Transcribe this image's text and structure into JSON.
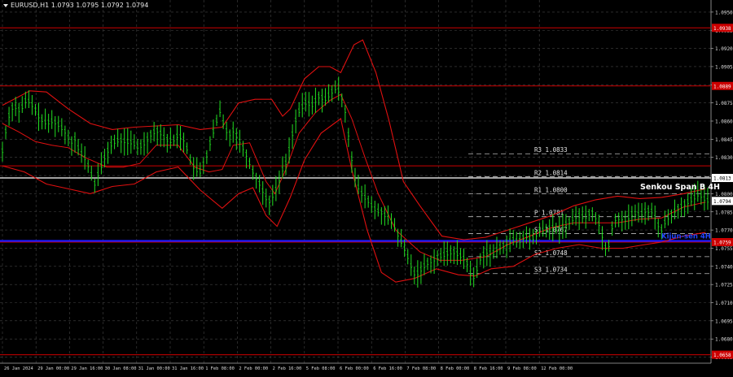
{
  "header": {
    "title": "EURUSD,H1  1.0793 1.0795 1.0792 1.0794"
  },
  "chart_data": {
    "type": "line",
    "title": "EURUSD,H1",
    "y_ticks": [
      "1.0950",
      "1.0935",
      "1.0920",
      "1.0905",
      "1.0890",
      "1.0875",
      "1.0860",
      "1.0845",
      "1.0830",
      "1.0815",
      "1.0800",
      "1.0785",
      "1.0770",
      "1.0755",
      "1.0740",
      "1.0725",
      "1.0710",
      "1.0695",
      "1.0680",
      "1.0665"
    ],
    "x_ticks": [
      "26 Jan 2024",
      "29 Jan 00:00",
      "29 Jan 16:00",
      "30 Jan 08:00",
      "31 Jan 00:00",
      "31 Jan 16:00",
      "1 Feb 08:00",
      "2 Feb 00:00",
      "2 Feb 16:00",
      "5 Feb 08:00",
      "6 Feb 00:00",
      "6 Feb 16:00",
      "7 Feb 08:00",
      "8 Feb 00:00",
      "8 Feb 16:00",
      "9 Feb 08:00",
      "12 Feb 00:00"
    ],
    "ylim": [
      1.066,
      1.096
    ],
    "price_labels": [
      {
        "text": "1.0938",
        "value": 1.0937,
        "color": "#cc0000"
      },
      {
        "text": "1.0889",
        "value": 1.0889,
        "color": "#cc0000"
      },
      {
        "text": "1.0813",
        "value": 1.0813,
        "color": "#ffffff"
      },
      {
        "text": "1.0794",
        "value": 1.0794,
        "color": "#ffffff"
      },
      {
        "text": "1.0759",
        "value": 1.076,
        "color": "#cc0000"
      },
      {
        "text": "1.0658",
        "value": 1.0667,
        "color": "#cc0000"
      }
    ],
    "pivots": [
      {
        "label": "R3 1.0833",
        "value": 1.0833
      },
      {
        "label": "R2 1.0814",
        "value": 1.0814
      },
      {
        "label": "R1 1.0800",
        "value": 1.08
      },
      {
        "label": "P 1.0781",
        "value": 1.0781
      },
      {
        "label": "S1 1.0767",
        "value": 1.0767
      },
      {
        "label": "S2 1.0748",
        "value": 1.0748
      },
      {
        "label": "S3 1.0734",
        "value": 1.0734
      }
    ],
    "levels": [
      {
        "value": 1.0937,
        "color": "#cc0000"
      },
      {
        "value": 1.0889,
        "color": "#cc0000"
      },
      {
        "value": 1.0823,
        "color": "#cc0000"
      },
      {
        "value": 1.076,
        "color": "#cc0000"
      },
      {
        "value": 1.0667,
        "color": "#cc0000"
      }
    ],
    "senkou_label": "Senkou Span B 4H",
    "senkou_value": 1.0813,
    "kijun_label": "Kijun-sen 4H",
    "kijun_value": 1.0761,
    "bollinger_mid": [
      [
        0,
        1.0858
      ],
      [
        15,
        1.0851
      ],
      [
        30,
        1.0843
      ],
      [
        45,
        1.084
      ],
      [
        60,
        1.0838
      ],
      [
        75,
        1.083
      ],
      [
        95,
        1.0822
      ],
      [
        110,
        1.0822
      ],
      [
        125,
        1.0825
      ],
      [
        140,
        1.084
      ],
      [
        150,
        1.084
      ],
      [
        160,
        1.084
      ],
      [
        175,
        1.0822
      ],
      [
        188,
        1.0818
      ],
      [
        200,
        1.082
      ],
      [
        210,
        1.084
      ],
      [
        225,
        1.0842
      ],
      [
        240,
        1.081
      ],
      [
        248,
        1.08
      ],
      [
        258,
        1.082
      ],
      [
        270,
        1.085
      ],
      [
        285,
        1.0867
      ],
      [
        298,
        1.0877
      ],
      [
        308,
        1.0882
      ],
      [
        318,
        1.0862
      ],
      [
        330,
        1.083
      ],
      [
        342,
        1.08
      ],
      [
        358,
        1.077
      ],
      [
        380,
        1.0752
      ],
      [
        398,
        1.0745
      ],
      [
        418,
        1.0745
      ],
      [
        440,
        1.0748
      ],
      [
        460,
        1.0758
      ],
      [
        480,
        1.0765
      ],
      [
        500,
        1.0772
      ],
      [
        520,
        1.0776
      ],
      [
        540,
        1.0776
      ],
      [
        560,
        1.0776
      ],
      [
        580,
        1.0779
      ],
      [
        600,
        1.078
      ],
      [
        620,
        1.0789
      ],
      [
        640,
        1.0793
      ]
    ],
    "bollinger_upper": [
      [
        0,
        1.0873
      ],
      [
        25,
        1.0885
      ],
      [
        40,
        1.0884
      ],
      [
        60,
        1.087
      ],
      [
        80,
        1.0858
      ],
      [
        100,
        1.0853
      ],
      [
        120,
        1.0855
      ],
      [
        140,
        1.0856
      ],
      [
        160,
        1.0857
      ],
      [
        180,
        1.0853
      ],
      [
        200,
        1.0855
      ],
      [
        215,
        1.0875
      ],
      [
        230,
        1.0878
      ],
      [
        245,
        1.0878
      ],
      [
        255,
        1.0864
      ],
      [
        262,
        1.087
      ],
      [
        275,
        1.0895
      ],
      [
        288,
        1.0905
      ],
      [
        298,
        1.0905
      ],
      [
        308,
        1.09
      ],
      [
        320,
        1.0923
      ],
      [
        328,
        1.0927
      ],
      [
        340,
        1.09
      ],
      [
        352,
        1.086
      ],
      [
        365,
        1.081
      ],
      [
        380,
        1.079
      ],
      [
        400,
        1.0765
      ],
      [
        420,
        1.0762
      ],
      [
        440,
        1.0764
      ],
      [
        460,
        1.077
      ],
      [
        480,
        1.0776
      ],
      [
        500,
        1.0782
      ],
      [
        520,
        1.079
      ],
      [
        540,
        1.0795
      ],
      [
        560,
        1.0798
      ],
      [
        580,
        1.0796
      ],
      [
        600,
        1.0797
      ],
      [
        620,
        1.08
      ],
      [
        640,
        1.0804
      ]
    ],
    "bollinger_lower": [
      [
        0,
        1.0823
      ],
      [
        20,
        1.0818
      ],
      [
        40,
        1.0808
      ],
      [
        60,
        1.0804
      ],
      [
        80,
        1.08
      ],
      [
        100,
        1.0806
      ],
      [
        120,
        1.0808
      ],
      [
        140,
        1.0818
      ],
      [
        160,
        1.0822
      ],
      [
        180,
        1.0803
      ],
      [
        200,
        1.0788
      ],
      [
        215,
        1.08
      ],
      [
        228,
        1.0805
      ],
      [
        240,
        1.0782
      ],
      [
        250,
        1.0773
      ],
      [
        262,
        1.0797
      ],
      [
        275,
        1.0828
      ],
      [
        290,
        1.085
      ],
      [
        308,
        1.0862
      ],
      [
        318,
        1.082
      ],
      [
        332,
        1.077
      ],
      [
        345,
        1.0735
      ],
      [
        358,
        1.0727
      ],
      [
        375,
        1.073
      ],
      [
        395,
        1.0738
      ],
      [
        415,
        1.0733
      ],
      [
        430,
        1.0732
      ],
      [
        445,
        1.0738
      ],
      [
        465,
        1.074
      ],
      [
        485,
        1.075
      ],
      [
        505,
        1.0755
      ],
      [
        525,
        1.0758
      ],
      [
        545,
        1.0755
      ],
      [
        565,
        1.0755
      ],
      [
        585,
        1.0758
      ],
      [
        600,
        1.076
      ],
      [
        620,
        1.0765
      ],
      [
        640,
        1.0768
      ]
    ],
    "price_path": [
      [
        0,
        1.0835
      ],
      [
        5,
        1.0862
      ],
      [
        10,
        1.0873
      ],
      [
        16,
        1.0868
      ],
      [
        22,
        1.0878
      ],
      [
        28,
        1.0872
      ],
      [
        34,
        1.0862
      ],
      [
        40,
        1.0858
      ],
      [
        46,
        1.086
      ],
      [
        52,
        1.0856
      ],
      [
        58,
        1.085
      ],
      [
        62,
        1.0842
      ],
      [
        66,
        1.0845
      ],
      [
        70,
        1.0835
      ],
      [
        76,
        1.0828
      ],
      [
        80,
        1.0818
      ],
      [
        84,
        1.0808
      ],
      [
        88,
        1.0818
      ],
      [
        94,
        1.0832
      ],
      [
        100,
        1.0842
      ],
      [
        106,
        1.0844
      ],
      [
        112,
        1.0843
      ],
      [
        118,
        1.0842
      ],
      [
        124,
        1.0838
      ],
      [
        130,
        1.0842
      ],
      [
        136,
        1.085
      ],
      [
        142,
        1.0852
      ],
      [
        148,
        1.0845
      ],
      [
        154,
        1.0843
      ],
      [
        160,
        1.0848
      ],
      [
        166,
        1.0844
      ],
      [
        170,
        1.083
      ],
      [
        175,
        1.082
      ],
      [
        180,
        1.0818
      ],
      [
        185,
        1.0828
      ],
      [
        190,
        1.0845
      ],
      [
        195,
        1.086
      ],
      [
        198,
        1.0868
      ],
      [
        202,
        1.0855
      ],
      [
        206,
        1.0848
      ],
      [
        210,
        1.0852
      ],
      [
        216,
        1.0843
      ],
      [
        222,
        1.0832
      ],
      [
        228,
        1.0818
      ],
      [
        234,
        1.0808
      ],
      [
        238,
        1.08
      ],
      [
        242,
        1.0792
      ],
      [
        246,
        1.0798
      ],
      [
        250,
        1.0805
      ],
      [
        254,
        1.0818
      ],
      [
        258,
        1.0825
      ],
      [
        262,
        1.084
      ],
      [
        266,
        1.0858
      ],
      [
        270,
        1.0868
      ],
      [
        276,
        1.0875
      ],
      [
        282,
        1.0873
      ],
      [
        288,
        1.088
      ],
      [
        294,
        1.0878
      ],
      [
        300,
        1.0884
      ],
      [
        304,
        1.0888
      ],
      [
        308,
        1.0882
      ],
      [
        312,
        1.0868
      ],
      [
        316,
        1.0842
      ],
      [
        320,
        1.0815
      ],
      [
        324,
        1.0805
      ],
      [
        328,
        1.0798
      ],
      [
        332,
        1.0795
      ],
      [
        336,
        1.079
      ],
      [
        340,
        1.0786
      ],
      [
        346,
        1.0784
      ],
      [
        350,
        1.078
      ],
      [
        356,
        1.0775
      ],
      [
        360,
        1.0766
      ],
      [
        364,
        1.0758
      ],
      [
        368,
        1.075
      ],
      [
        372,
        1.074
      ],
      [
        376,
        1.0732
      ],
      [
        380,
        1.0736
      ],
      [
        386,
        1.0742
      ],
      [
        392,
        1.0745
      ],
      [
        398,
        1.0748
      ],
      [
        404,
        1.075
      ],
      [
        410,
        1.0752
      ],
      [
        416,
        1.0749
      ],
      [
        422,
        1.0745
      ],
      [
        426,
        1.0734
      ],
      [
        430,
        1.073
      ],
      [
        434,
        1.0745
      ],
      [
        440,
        1.0752
      ],
      [
        446,
        1.075
      ],
      [
        452,
        1.0755
      ],
      [
        458,
        1.0758
      ],
      [
        464,
        1.0762
      ],
      [
        470,
        1.076
      ],
      [
        476,
        1.0765
      ],
      [
        482,
        1.0762
      ],
      [
        488,
        1.0768
      ],
      [
        494,
        1.077
      ],
      [
        500,
        1.0772
      ],
      [
        506,
        1.077
      ],
      [
        512,
        1.0774
      ],
      [
        518,
        1.0778
      ],
      [
        524,
        1.0782
      ],
      [
        530,
        1.078
      ],
      [
        536,
        1.0785
      ],
      [
        542,
        1.0778
      ],
      [
        546,
        1.0765
      ],
      [
        550,
        1.0752
      ],
      [
        553,
        1.076
      ],
      [
        556,
        1.0778
      ],
      [
        562,
        1.078
      ],
      [
        568,
        1.0778
      ],
      [
        574,
        1.0784
      ],
      [
        580,
        1.0782
      ],
      [
        586,
        1.0786
      ],
      [
        592,
        1.0785
      ],
      [
        596,
        1.0775
      ],
      [
        600,
        1.077
      ],
      [
        604,
        1.0778
      ],
      [
        610,
        1.0784
      ],
      [
        616,
        1.0788
      ],
      [
        622,
        1.0792
      ],
      [
        628,
        1.0795
      ],
      [
        634,
        1.08
      ],
      [
        638,
        1.0796
      ],
      [
        642,
        1.0794
      ]
    ]
  }
}
